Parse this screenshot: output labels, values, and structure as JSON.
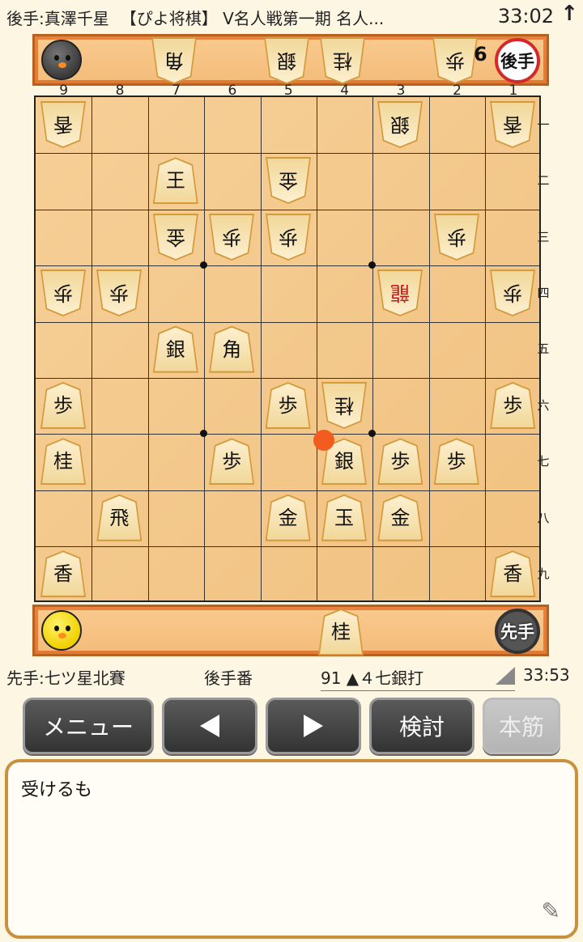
{
  "header": {
    "gote_player": "後手:真澤千星",
    "title": "【ぴよ将棋】 V名人戦第一期 名人...",
    "gote_clock": "33:02",
    "arrow": "↑"
  },
  "gote_stand": {
    "pieces": [
      {
        "label": "角",
        "col": 7
      },
      {
        "label": "銀",
        "col": 5
      },
      {
        "label": "桂",
        "col": 4
      },
      {
        "label": "歩",
        "col": 2
      }
    ],
    "pawn_count": "6",
    "badge": "後手"
  },
  "sente_stand": {
    "pieces": [
      {
        "label": "桂"
      }
    ],
    "badge": "先手"
  },
  "board": {
    "col_labels": [
      "9",
      "8",
      "7",
      "6",
      "5",
      "4",
      "3",
      "2",
      "1"
    ],
    "row_labels": [
      "一",
      "二",
      "三",
      "四",
      "五",
      "六",
      "七",
      "八",
      "九"
    ],
    "pieces": [
      {
        "label": "香",
        "file": 9,
        "rank": 1,
        "owner": "gote"
      },
      {
        "label": "銀",
        "file": 3,
        "rank": 1,
        "owner": "gote"
      },
      {
        "label": "香",
        "file": 1,
        "rank": 1,
        "owner": "gote"
      },
      {
        "label": "王",
        "file": 7,
        "rank": 2,
        "owner": "sente_style"
      },
      {
        "label": "金",
        "file": 5,
        "rank": 2,
        "owner": "gote"
      },
      {
        "label": "金",
        "file": 7,
        "rank": 3,
        "owner": "gote"
      },
      {
        "label": "歩",
        "file": 6,
        "rank": 3,
        "owner": "gote"
      },
      {
        "label": "歩",
        "file": 5,
        "rank": 3,
        "owner": "gote"
      },
      {
        "label": "歩",
        "file": 2,
        "rank": 3,
        "owner": "gote"
      },
      {
        "label": "歩",
        "file": 9,
        "rank": 4,
        "owner": "gote"
      },
      {
        "label": "歩",
        "file": 8,
        "rank": 4,
        "owner": "gote"
      },
      {
        "label": "龍",
        "file": 3,
        "rank": 4,
        "owner": "gote",
        "promoted": true
      },
      {
        "label": "歩",
        "file": 1,
        "rank": 4,
        "owner": "gote"
      },
      {
        "label": "銀",
        "file": 7,
        "rank": 5,
        "owner": "sente"
      },
      {
        "label": "角",
        "file": 6,
        "rank": 5,
        "owner": "sente"
      },
      {
        "label": "歩",
        "file": 9,
        "rank": 6,
        "owner": "sente"
      },
      {
        "label": "歩",
        "file": 5,
        "rank": 6,
        "owner": "sente"
      },
      {
        "label": "桂",
        "file": 4,
        "rank": 6,
        "owner": "gote"
      },
      {
        "label": "歩",
        "file": 1,
        "rank": 6,
        "owner": "sente"
      },
      {
        "label": "桂",
        "file": 9,
        "rank": 7,
        "owner": "sente"
      },
      {
        "label": "歩",
        "file": 6,
        "rank": 7,
        "owner": "sente"
      },
      {
        "label": "銀",
        "file": 4,
        "rank": 7,
        "owner": "sente"
      },
      {
        "label": "歩",
        "file": 3,
        "rank": 7,
        "owner": "sente"
      },
      {
        "label": "歩",
        "file": 2,
        "rank": 7,
        "owner": "sente"
      },
      {
        "label": "飛",
        "file": 8,
        "rank": 8,
        "owner": "sente"
      },
      {
        "label": "金",
        "file": 5,
        "rank": 8,
        "owner": "sente"
      },
      {
        "label": "玉",
        "file": 4,
        "rank": 8,
        "owner": "sente"
      },
      {
        "label": "金",
        "file": 3,
        "rank": 8,
        "owner": "sente"
      },
      {
        "label": "香",
        "file": 9,
        "rank": 9,
        "owner": "sente"
      },
      {
        "label": "香",
        "file": 1,
        "rank": 9,
        "owner": "sente"
      }
    ],
    "last_move_marker": {
      "file": 4,
      "rank": 7
    }
  },
  "status": {
    "sente_player": "先手:七ツ星北賽",
    "turn": "後手番",
    "last_move": "91 ▲４七銀打",
    "sente_clock": "33:53"
  },
  "buttons": {
    "menu": "メニュー",
    "study": "検討",
    "mainline": "本筋"
  },
  "comment": {
    "text": "受けるも"
  },
  "colors": {
    "stand": "#e07a34",
    "board": "#f3c68a",
    "promoted": "#c8161d",
    "move_marker": "#f25c1f"
  }
}
